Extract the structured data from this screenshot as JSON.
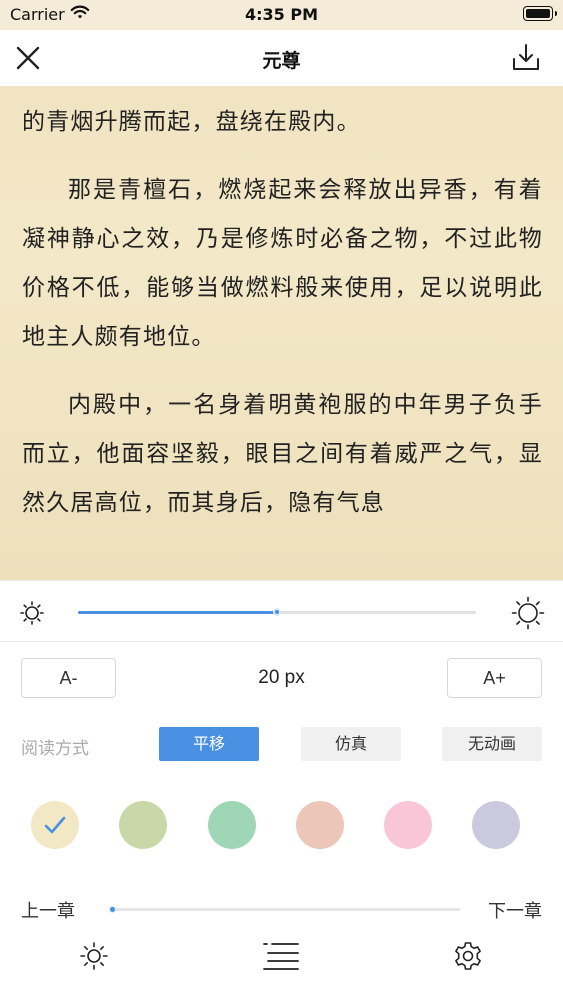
{
  "status_bar": {
    "carrier": "Carrier",
    "time": "4:35 PM",
    "wifi_icon": "wifi-icon",
    "battery_icon": "battery-icon"
  },
  "nav": {
    "title": "元尊",
    "close_icon": "close-icon",
    "download_icon": "download-icon"
  },
  "reader": {
    "paragraphs": [
      {
        "text": "对天庭明时问殿之中，蓝石铺地，气势威严，殿内有着长明灯燃烧，其中燃烧着一颗青石，袅袅的青烟升腾而起，盘绕在殿内。",
        "continuation": true
      },
      {
        "text": "那是青檀石，燃烧起来会释放出异香，有着凝神静心之效，乃是修炼时必备之物，不过此物价格不低，能够当做燃料般来使用，足以说明此地主人颇有地位。",
        "continuation": false
      },
      {
        "text": "内殿中，一名身着明黄袍服的中年男子负手而立，他面容坚毅，眼目之间有着威严之气，显然久居高位，而其身后，隐有气息",
        "continuation": false
      }
    ]
  },
  "brightness": {
    "value": 0.5,
    "low_icon": "sun-small-icon",
    "high_icon": "sun-large-icon"
  },
  "font": {
    "decrease_label": "A-",
    "increase_label": "A+",
    "size_text": "20 px"
  },
  "mode": {
    "label": "阅读方式",
    "options": [
      "平移",
      "仿真",
      "无动画"
    ],
    "selected": "平移"
  },
  "backgrounds": {
    "swatches": [
      "#f3e8c5",
      "#c8d8a8",
      "#9fd6b5",
      "#ebc6b9",
      "#f9c6d8",
      "#cbc9dd"
    ],
    "selected_index": 0,
    "check_icon": "checkmark-icon",
    "accent": "#4a90e2"
  },
  "chapter": {
    "prev_label": "上一章",
    "next_label": "下一章",
    "progress": 0.0
  },
  "tab_bar": {
    "icons": [
      "brightness-icon",
      "table-of-contents-icon",
      "settings-gear-icon"
    ]
  }
}
